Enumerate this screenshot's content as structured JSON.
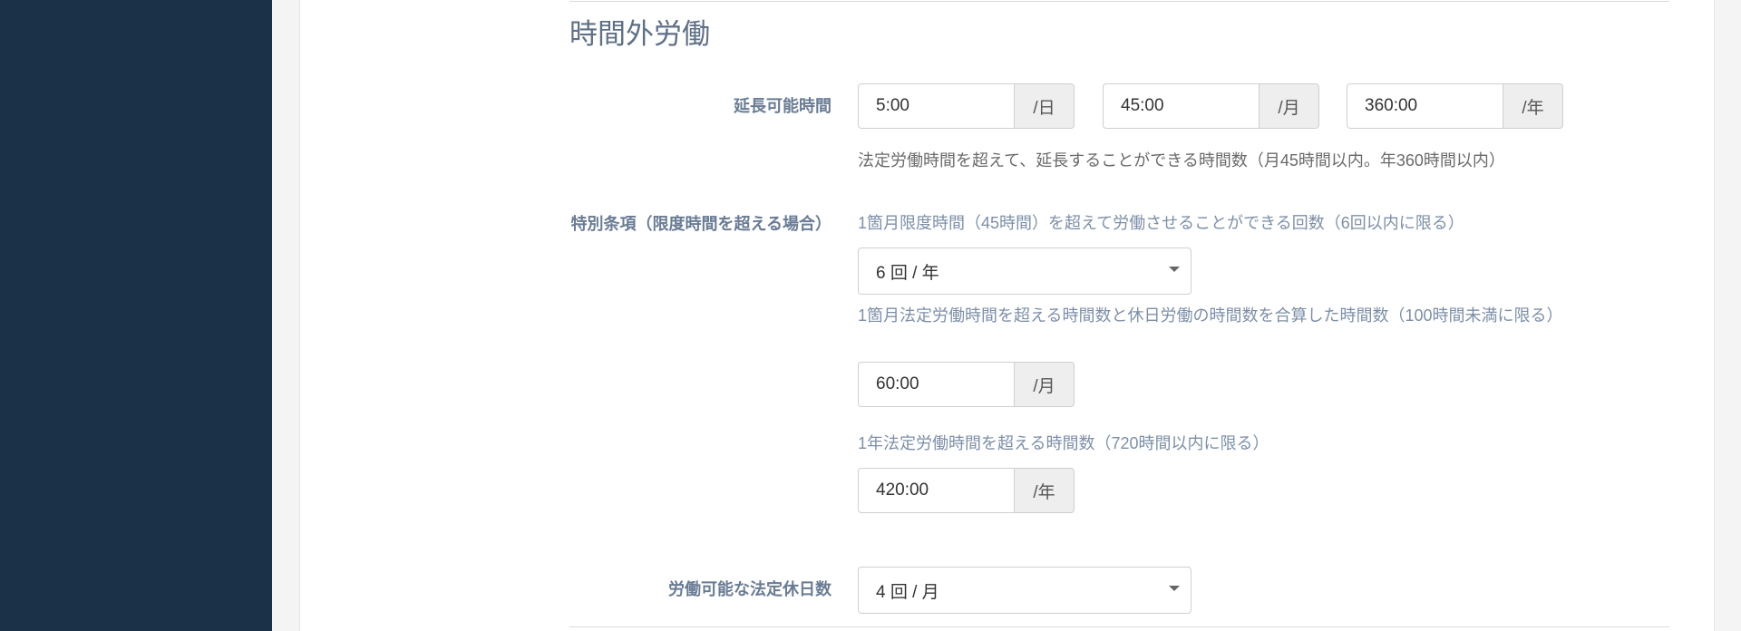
{
  "section": {
    "title": "時間外労働"
  },
  "extension": {
    "label": "延長可能時間",
    "day": {
      "value": "5:00",
      "unit": "/日"
    },
    "month": {
      "value": "45:00",
      "unit": "/月"
    },
    "year": {
      "value": "360:00",
      "unit": "/年"
    },
    "help": "法定労働時間を超えて、延長することができる時間数（月45時間以内。年360時間以内）"
  },
  "special": {
    "label": "特別条項（限度時間を超える場合）",
    "count_help": "1箇月限度時間（45時間）を超えて労働させることができる回数（6回以内に限る）",
    "count_select": "6 回 / 年",
    "monthly_help": "1箇月法定労働時間を超える時間数と休日労働の時間数を合算した時間数（100時間未満に限る）",
    "monthly": {
      "value": "60:00",
      "unit": "/月"
    },
    "yearly_help": "1年法定労働時間を超える時間数（720時間以内に限る）",
    "yearly": {
      "value": "420:00",
      "unit": "/年"
    }
  },
  "holidays": {
    "label": "労働可能な法定休日数",
    "select": "4 回 / 月"
  }
}
